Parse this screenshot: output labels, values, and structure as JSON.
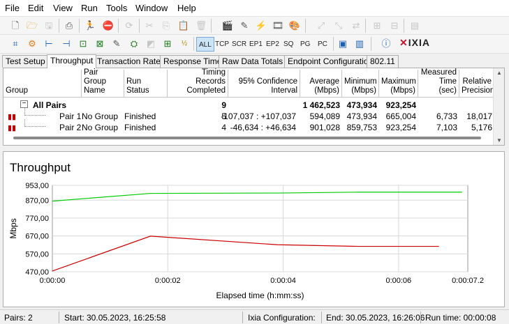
{
  "menu": [
    "File",
    "Edit",
    "View",
    "Run",
    "Tools",
    "Window",
    "Help"
  ],
  "toolbar2": {
    "filters": [
      "ALL",
      "TCP",
      "SCR",
      "EP1",
      "EP2",
      "SQ",
      "PG",
      "PC"
    ],
    "logo": "IXIA"
  },
  "tabs": [
    "Test Setup",
    "Throughput",
    "Transaction Rate",
    "Response Time",
    "Raw Data Totals",
    "Endpoint Configuration",
    "802.11"
  ],
  "active_tab": "Throughput",
  "grid": {
    "headers": [
      "Group",
      "Pair Group\nName",
      "Run Status",
      "Timing Records\nCompleted",
      "95% Confidence\nInterval",
      "Average\n(Mbps)",
      "Minimum\n(Mbps)",
      "Maximum\n(Mbps)",
      "Measured\nTime (sec)",
      "Relative\nPrecision"
    ],
    "summary": {
      "label": "All Pairs",
      "records": "9",
      "average": "1 462,523",
      "minimum": "473,934",
      "maximum": "923,254"
    },
    "rows": [
      {
        "pair": "Pair 1",
        "group": "No Group",
        "status": "Finished",
        "records": "5",
        "ci": "-107,037 : +107,037",
        "average": "594,089",
        "minimum": "473,934",
        "maximum": "665,004",
        "time": "6,733",
        "precision": "18,017"
      },
      {
        "pair": "Pair 2",
        "group": "No Group",
        "status": "Finished",
        "records": "4",
        "ci": "-46,634 : +46,634",
        "average": "901,028",
        "minimum": "859,753",
        "maximum": "923,254",
        "time": "7,103",
        "precision": "5,176"
      }
    ]
  },
  "chart_data": {
    "type": "line",
    "title": "Throughput",
    "xlabel": "Elapsed time (h:mm:ss)",
    "ylabel": "Mbps",
    "xlim": [
      0,
      7.2
    ],
    "ylim": [
      470,
      953
    ],
    "yticks": [
      470,
      570,
      670,
      770,
      870,
      953
    ],
    "ytick_labels": [
      "470,00",
      "570,00",
      "670,00",
      "770,00",
      "870,00",
      "953,00"
    ],
    "xticks": [
      0,
      2,
      4,
      6,
      7.2
    ],
    "xtick_labels": [
      "0:00:00",
      "0:00:02",
      "0:00:04",
      "0:00:06",
      "0:00:07.2"
    ],
    "grid": true,
    "series": [
      {
        "color": "#00cc00",
        "x": [
          0,
          1.7,
          3.9,
          5.3,
          7.1
        ],
        "y": [
          865,
          908,
          910,
          915,
          915
        ]
      },
      {
        "color": "#cc0000",
        "x": [
          0,
          1.7,
          3.9,
          5.3,
          6.7
        ],
        "y": [
          474,
          669,
          621,
          612,
          612
        ]
      }
    ]
  },
  "status": {
    "pairs": "Pairs: 2",
    "start": "Start: 30.05.2023, 16:25:58",
    "ixia_config": "Ixia Configuration:",
    "end": "End: 30.05.2023, 16:26:06",
    "runtime": "Run time: 00:00:08"
  }
}
